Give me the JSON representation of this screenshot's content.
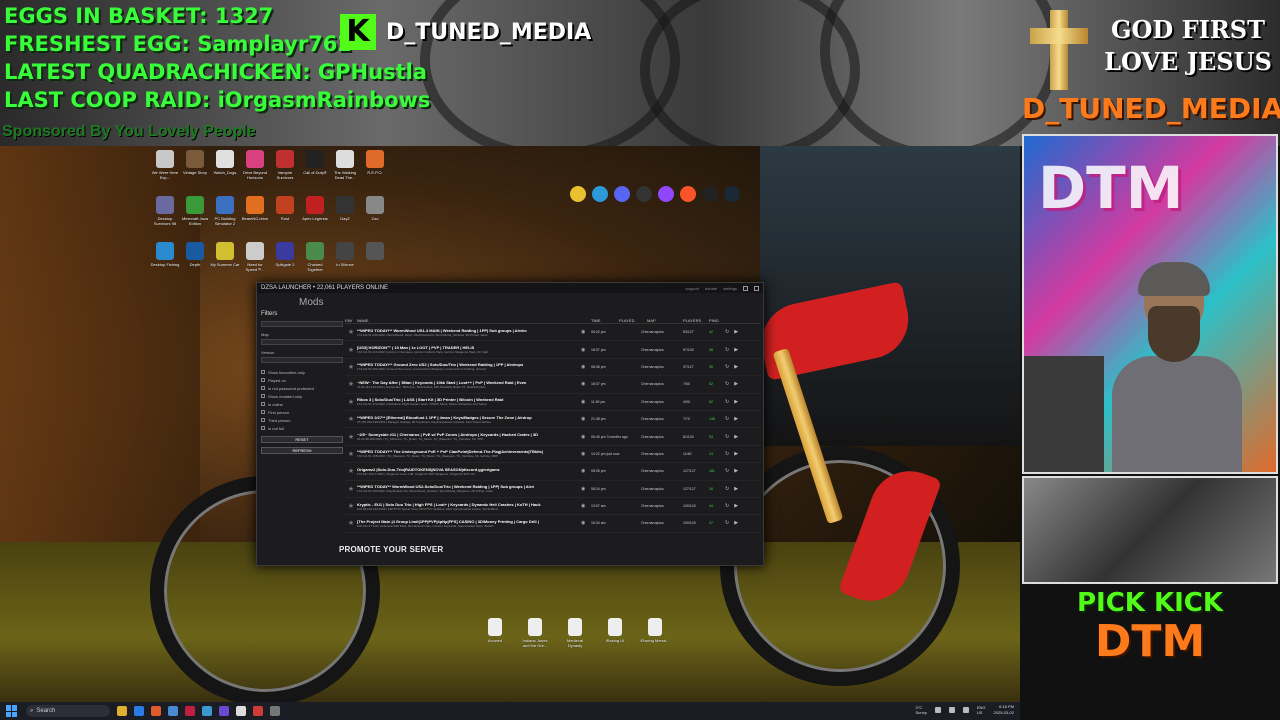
{
  "overlay": {
    "stats": [
      "EGGS IN BASKET: 1327",
      "FRESHEST EGG: Samplayr762",
      "LATEST QUADRACHICKEN: GPHustla",
      "LAST COOP RAID: iOrgasmRainbows"
    ],
    "sponsor": "Sponsored By You Lovely People",
    "kick_logo": "K",
    "channel_name": "D_TUNED_MEDIA",
    "god_line1": "GOD FIRST",
    "god_line2": "LOVE JESUS",
    "channel_name_orange": "D_TUNED_MEDIA",
    "webcam_sign": "DTM",
    "pick_kick": "PICK KICK",
    "pick_dtm": "DTM"
  },
  "desktop": {
    "icons": [
      {
        "label": "We Were Here Exp...",
        "color": "#c8c8c8"
      },
      {
        "label": "Vintage Story",
        "color": "#7a5a3a"
      },
      {
        "label": "Watch_Dogs",
        "color": "#e0e0e0"
      },
      {
        "label": "Drive Beyond Horizons",
        "color": "#d94080"
      },
      {
        "label": "Vampire Survivors",
        "color": "#c03030"
      },
      {
        "label": "Call of Duty®",
        "color": "#222"
      },
      {
        "label": "The Walking Dead The...",
        "color": "#ddd"
      },
      {
        "label": "R.E.P.O.",
        "color": "#e06a2a"
      },
      {
        "label": "Desktop Survivors 98",
        "color": "#6a6aa0"
      },
      {
        "label": "Minecraft Java Edition",
        "color": "#3a9a3a"
      },
      {
        "label": "PC Building Simulator 2",
        "color": "#3a70c0"
      },
      {
        "label": "BeamNG.drive",
        "color": "#e07020"
      },
      {
        "label": "Rust",
        "color": "#c04020"
      },
      {
        "label": "Apex Legends",
        "color": "#c02020"
      },
      {
        "label": "DayZ",
        "color": "#333"
      },
      {
        "label": "Zoo",
        "color": "#888"
      },
      {
        "label": "Desktop Fishing",
        "color": "#2a8ad0"
      },
      {
        "label": "Depth",
        "color": "#1a5aa0"
      },
      {
        "label": "My Summer Car",
        "color": "#d0c030"
      },
      {
        "label": "Need for Speed™...",
        "color": "#ccc"
      },
      {
        "label": "Splitgate 2",
        "color": "#3a3aa0"
      },
      {
        "label": "Chained Together",
        "color": "#4a8a4a"
      },
      {
        "label": "In Silence",
        "color": "#444"
      },
      {
        "label": "",
        "color": "#555"
      }
    ],
    "bottom_icons": [
      "Avowed",
      "Indiana Jones and the Gre...",
      "Medieval Dynasty",
      "iRacing UI",
      "iRacing Memb..."
    ]
  },
  "launcher": {
    "title": "DZSA LAUNCHER • 22,061 PLAYERS ONLINE",
    "header_links": [
      "support",
      "donate",
      "settings"
    ],
    "tab": "Mods",
    "filters": {
      "title": "Filters",
      "map_label": "Map",
      "version_label": "Version",
      "checks": [
        "Show favourites only",
        "Played on",
        "Is not password protected",
        "Show modded only",
        "Is online",
        "First person",
        "Third person",
        "Is not full"
      ],
      "reset": "RESET",
      "refresh": "REFRESH"
    },
    "columns": {
      "fav": "FAV",
      "name": "NAME",
      "time": "TIME",
      "played": "PLAYED",
      "map": "MAP",
      "players": "PLAYERS",
      "ping": "PING"
    },
    "rows": [
      {
        "name": "**WIPED TODAY!** WormWood US1-3 MAIN | Weekend Raiding | 1PP| Sub groups | Airdro",
        "sub": "172.111.51.230:2302 | WormWood, DayZ, DayZCasinoV2, WormWood_Vehicles, 3D Printer, Addo",
        "time": "06:22 pm",
        "map": "Chernarusplus",
        "players": "83/127",
        "ping": "42"
      },
      {
        "name": "[US3] HORIZON™ | 10 Man | 1x LOOT | PVP | TRADER | HELIS",
        "sub": "172.111.51.214:2402 | Horizon Chernarus, Horizon Vehicle Pack, Horizon Weapons Pack, CF, Dab",
        "time": "18:07 pm",
        "map": "Chernarusplus",
        "players": "57/100",
        "ping": "38"
      },
      {
        "name": "**WIPED TODAY!** Ground Zero US2 | Solo/Duo/Trio | Weekend Raiding | 1PP | Airdrops",
        "sub": "172.111.51.232:2402 | Ground Zero Core, Ground Zero Weapons, Ground Zero Clothing, Ground",
        "time": "06:36 pm",
        "map": "Chernarusplus",
        "players": "37/127",
        "ping": "36"
      },
      {
        "name": "~NEW~ The Day After | 5Man | Keycards | 10kk Start | Loot++ | PvP | Weekend Raid | Even",
        "sub": "74.91.113.162:2402 | GameLabs, TDACore, TDAClothes, RW Packable Boats V2, RaidSchedule",
        "time": "18:07 pm",
        "map": "Chernarusplus",
        "players": "7/60",
        "ping": "52"
      },
      {
        "name": "Rikos 3 | Solo/Duo/Trio | LASS | Start Kit | 3D Printer | Bitcoin | Weekend Raid",
        "sub": "172.111.51.170:2402 | NetFalcon Flight System Helis, TWIGS Stims, Tarkov Extraction And Setup",
        "time": "11:59 pm",
        "map": "Chernarusplus",
        "players": "4/90",
        "ping": "52"
      },
      {
        "name": "**WIPED 2/27** [Ethereal] Bloodlust 1 1PP | 4man | Keys/Badges | Secure The Zone | Airdrop",
        "sub": "37.187.226.138:2302 | Paragon Storage, BL Keyfusion, DayZ-Expansion-Quests, Fast Travel, Ethere",
        "time": "21:38 pm",
        "map": "Chernarusplus",
        "players": "7/70",
        "ping": "148"
      },
      {
        "name": "~2/5~ Sunnyside #11 | Chernarus | PvE w/ PvP Zones | Airdrops | Keycards | Hacked Crates | 3D",
        "sub": "54.20.38.180:2302 | TU_Missions, TU_Relax, TU_Music, TU_Weapons, TU_Vehicles, CF, VPP...",
        "time": "06:40 pm 3 months ago",
        "map": "Chernarusplus",
        "players": "81/100",
        "ping": "53"
      },
      {
        "name": "**WIPED TODAY!** The Underground PvE + PvP ClanPoint|Defend-The-Flag|Achievements|TBkits|",
        "sub": "172.111.51.168:2302 | TU_Missions, TU_Relax, TU_Music, TU_Weapons, TU_Vehicles, CF, Vehicle_MRP",
        "time": "10:22 pm just now",
        "map": "Chernarusplus",
        "players": "11/60",
        "ping": "24"
      },
      {
        "name": "Origamz2 |Solo-Duo-Trio|RAIDTOKENS|NOVA SEASON|discord.gg/origamz",
        "sub": "172.107.164.7:2302 | Origamz2 Core 1.28, Origamz2 SDT Weapons, Origamz2 SDT Clo",
        "time": "08:26 pm",
        "map": "Chernarusplus",
        "players": "127/127",
        "ping": "181"
      },
      {
        "name": "**WIPED TODAY** WormWood US2-Solo/Duo/Trio | Weekend Raiding | 1PP| Sub groups | Aird",
        "sub": "172.111.51.230:2402 | DayZCasinoV2, WormWood_Vehicles, WormWood_Weapons, 3D Printer, Addo",
        "time": "08:24 pm",
        "map": "Chernarusplus",
        "players": "127/127",
        "ping": "16"
      },
      {
        "name": "Kryptic - EU1 | Solo Duo Trio | High FPS | Loot+ | Keycards | Dynamic Heli Crashes | KoTH | Hack",
        "sub": "100.96.146.140:2302 | KRYPTIC Server Core, KRYPTIC Vehicles, EDC Gamemodule Assets, TerrainMod",
        "time": "13:07 am",
        "map": "Chernarusplus",
        "players": "100/120",
        "ping": "44"
      },
      {
        "name": "[The Project Main |4 Group Limit|1PP|PVP|4pNp|FPS] CASINO | 3D/Money Printing | Cargo Drill |",
        "sub": "100.101.47.110 | HelicopterSIM Pack, 8A Hacked Crate, Custom Keycards, Supermarket Store, Buildin",
        "time": "16:34 am",
        "map": "Chernarusplus",
        "players": "100/100",
        "ping": "47"
      }
    ],
    "promote": "PROMOTE YOUR SERVER"
  },
  "taskbar": {
    "search_placeholder": "Search",
    "apps": [
      "#e0b030",
      "#2c7be5",
      "#e05a2a",
      "#4a8ad0",
      "#c02040",
      "#3a9ad0",
      "#6a4ad0",
      "#ddd",
      "#d23a3a",
      "#777"
    ],
    "weather_temp": "3°C",
    "weather_desc": "Sunny",
    "lang": "ENG",
    "region": "US",
    "time": "6:18 PM",
    "date": "2025-03-02"
  }
}
